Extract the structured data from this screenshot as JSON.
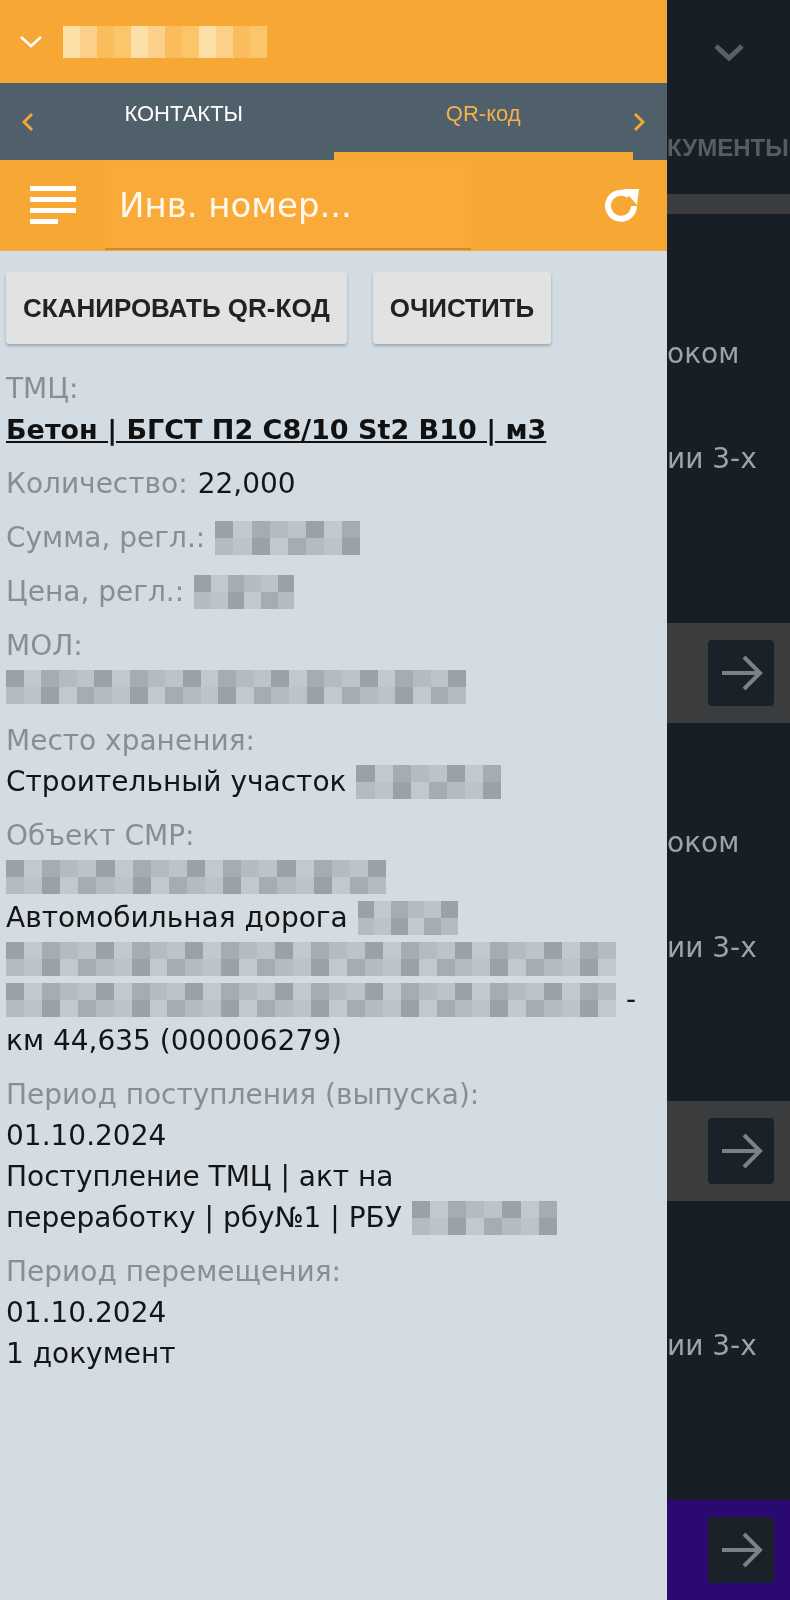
{
  "header": {
    "title_redacted": true
  },
  "tabs": [
    {
      "label": "КОНТАКТЫ",
      "selected": false
    },
    {
      "label": "QR-код",
      "selected": true
    }
  ],
  "search": {
    "placeholder": "Инв. номер..."
  },
  "buttons": [
    "СКАНИРОВАТЬ QR-КОД",
    "ОЧИСТИТЬ"
  ],
  "groups": [
    {
      "rows": [
        [
          {
            "kind": "label",
            "text": "ТМЦ:"
          }
        ],
        [
          {
            "kind": "link",
            "text": "Бетон | БГСТ П2 С8/10 St2 B10 | м3"
          }
        ]
      ]
    },
    {
      "rows": [
        [
          {
            "kind": "label",
            "text": "Количество:"
          },
          {
            "kind": "value",
            "text": "22,000"
          }
        ]
      ]
    },
    {
      "rows": [
        [
          {
            "kind": "label",
            "text": "Сумма, регл.:"
          },
          {
            "kind": "maskmedium"
          }
        ]
      ]
    },
    {
      "rows": [
        [
          {
            "kind": "label",
            "text": "Цена, регл.:"
          },
          {
            "kind": "masksmall"
          }
        ]
      ]
    },
    {
      "rows": [
        [
          {
            "kind": "label",
            "text": "МОЛ:"
          }
        ],
        [
          {
            "kind": "maskxlong"
          }
        ]
      ]
    },
    {
      "rows": [
        [
          {
            "kind": "label",
            "text": "Место хранения:"
          }
        ],
        [
          {
            "kind": "value",
            "text": "Строительный участок"
          },
          {
            "kind": "maskmedium"
          }
        ]
      ]
    },
    {
      "rows": [
        [
          {
            "kind": "label",
            "text": "Объект СМР:"
          }
        ],
        [
          {
            "kind": "masklong"
          }
        ],
        [
          {
            "kind": "value",
            "text": "Автомобильная дорога"
          },
          {
            "kind": "masksmall"
          }
        ],
        [
          {
            "kind": "maskline"
          }
        ],
        [
          {
            "kind": "maskline"
          },
          {
            "kind": "value",
            "text": "-"
          }
        ],
        [
          {
            "kind": "value",
            "text": "км 44,635 (000006279)"
          }
        ]
      ]
    },
    {
      "rows": [
        [
          {
            "kind": "label",
            "text": "Период поступления (выпуска):"
          }
        ],
        [
          {
            "kind": "value",
            "text": "01.10.2024"
          }
        ],
        [
          {
            "kind": "value",
            "text": "Поступление ТМЦ | акт на"
          }
        ],
        [
          {
            "kind": "value",
            "text": "переработку | рбу№1 | РБУ"
          },
          {
            "kind": "maskmedium"
          }
        ]
      ]
    },
    {
      "rows": [
        [
          {
            "kind": "label",
            "text": "Период перемещения:"
          }
        ],
        [
          {
            "kind": "value",
            "text": "01.10.2024"
          }
        ],
        [
          {
            "kind": "value",
            "text": "1 документ"
          }
        ]
      ]
    }
  ],
  "background_screen": {
    "heading": "КУМЕНТЫ",
    "cards": [
      {
        "lines": [
          "оком",
          "ии 3-х"
        ]
      },
      {
        "lines": [
          "оком",
          "ии 3-х"
        ]
      },
      {
        "lines": [
          "ии 3-х"
        ]
      }
    ]
  }
}
